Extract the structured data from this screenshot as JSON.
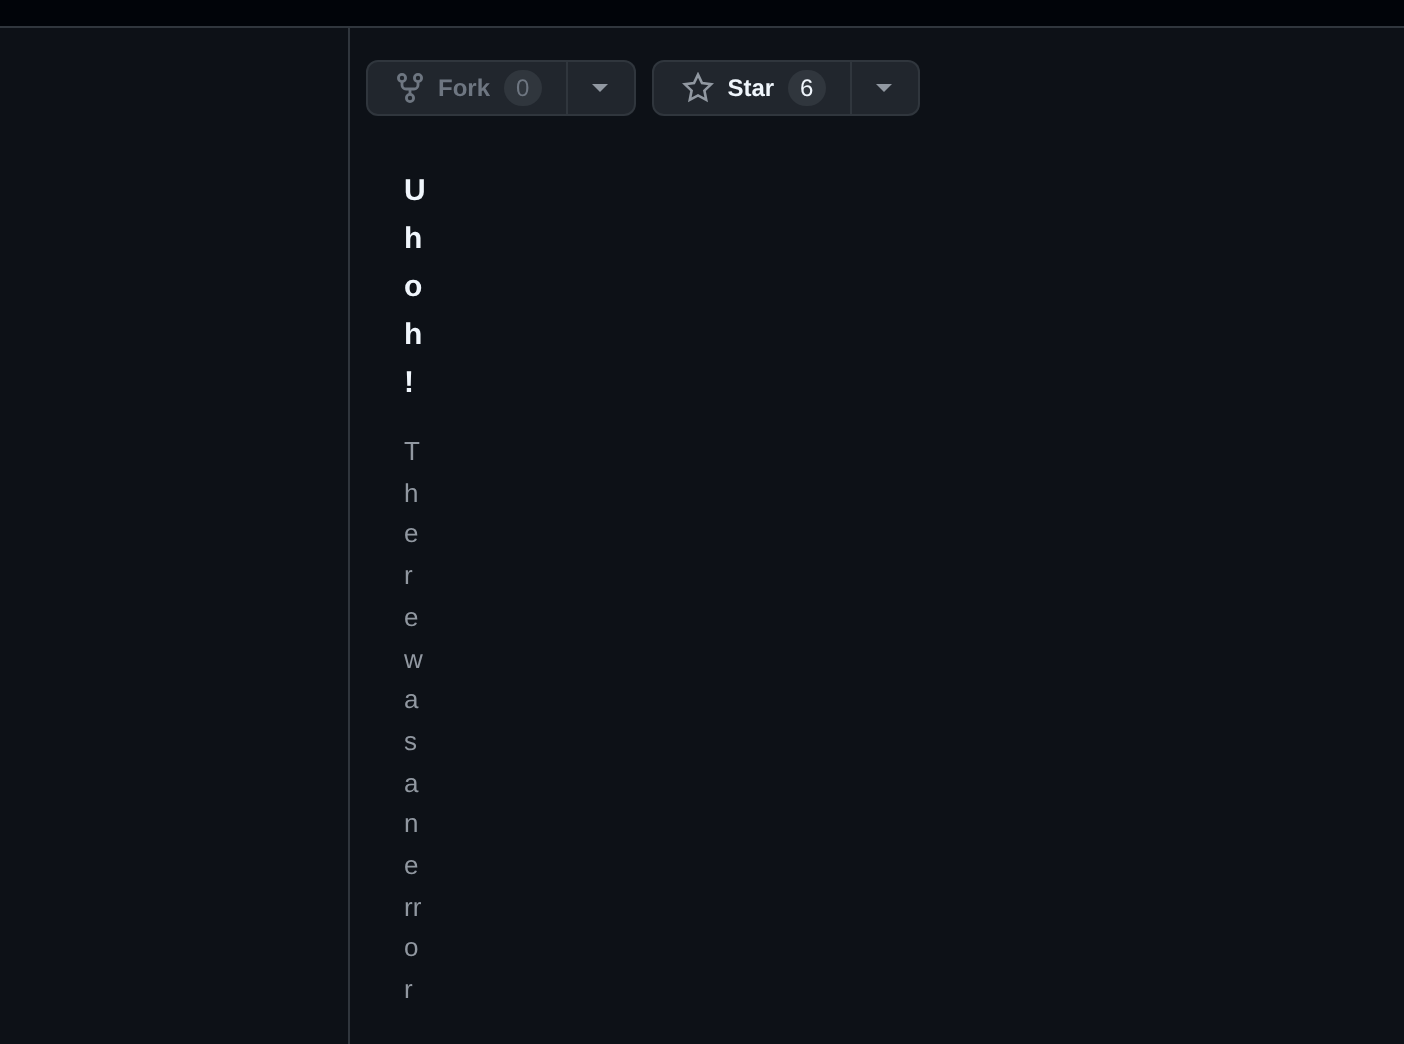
{
  "actions": [
    {
      "kind": "fork",
      "label": "Fork",
      "count": "0",
      "disabled": true
    },
    {
      "kind": "star",
      "label": "Star",
      "count": "6",
      "disabled": false
    }
  ],
  "error": {
    "title": "Uh oh!",
    "message": "There was an error"
  }
}
